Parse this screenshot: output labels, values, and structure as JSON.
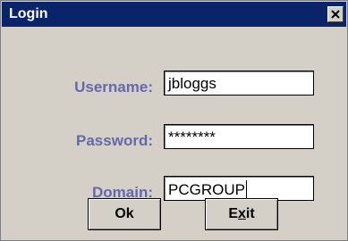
{
  "window": {
    "title": "Login",
    "close_glyph": "close-icon"
  },
  "form": {
    "username_label": "Username:",
    "username_value": "jbloggs",
    "password_label": "Password:",
    "password_value": "********",
    "domain_label": "Domain:",
    "domain_value": "PCGROUP"
  },
  "buttons": {
    "ok_label": "Ok",
    "exit_label_pre": "E",
    "exit_label_mnemonic": "x",
    "exit_label_post": "it"
  },
  "colors": {
    "titlebar": "#0a246a",
    "label": "#6668a8",
    "background": "#d4d0c8"
  }
}
